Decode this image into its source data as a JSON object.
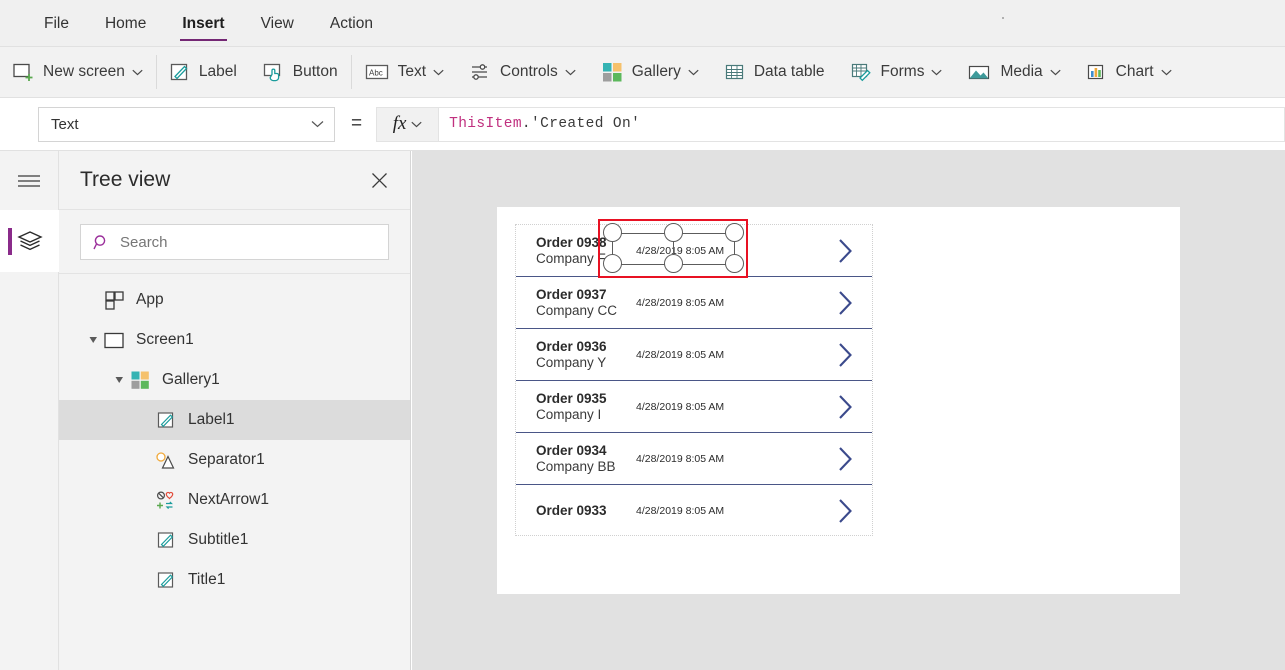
{
  "menu": {
    "items": [
      {
        "label": "File",
        "active": false
      },
      {
        "label": "Home",
        "active": false
      },
      {
        "label": "Insert",
        "active": true
      },
      {
        "label": "View",
        "active": false
      },
      {
        "label": "Action",
        "active": false
      }
    ]
  },
  "ribbon": {
    "items": [
      {
        "label": "New screen",
        "icon": "new-screen-icon",
        "caret": true
      },
      {
        "label": "Label",
        "icon": "label-icon",
        "caret": false
      },
      {
        "label": "Button",
        "icon": "button-icon",
        "caret": false
      },
      {
        "label": "Text",
        "icon": "text-abc-icon",
        "caret": true
      },
      {
        "label": "Controls",
        "icon": "controls-sliders-icon",
        "caret": true
      },
      {
        "label": "Gallery",
        "icon": "gallery-grid-icon",
        "caret": true
      },
      {
        "label": "Data table",
        "icon": "data-table-icon",
        "caret": false
      },
      {
        "label": "Forms",
        "icon": "forms-icon",
        "caret": true
      },
      {
        "label": "Media",
        "icon": "media-image-icon",
        "caret": true
      },
      {
        "label": "Chart",
        "icon": "chart-bar-icon",
        "caret": true
      }
    ]
  },
  "formula_bar": {
    "property": "Text",
    "equals": "=",
    "fx_label": "fx",
    "formula_object": "ThisItem",
    "formula_rest": ".'Created On'",
    "formula_full": "ThisItem.'Created On'"
  },
  "rail": {
    "hamburger_icon": "hamburger-menu-icon",
    "layers_icon": "layers-tree-view-icon"
  },
  "tree_view": {
    "title": "Tree view",
    "close_icon": "close-icon",
    "search": {
      "placeholder": "Search",
      "icon": "search-icon"
    },
    "nodes": [
      {
        "label": "App",
        "icon": "app-icon",
        "indent": 1,
        "twisty": "none",
        "selected": false
      },
      {
        "label": "Screen1",
        "icon": "screen-icon",
        "indent": 1,
        "twisty": "expanded",
        "selected": false
      },
      {
        "label": "Gallery1",
        "icon": "gallery-icon",
        "indent": 2,
        "twisty": "expanded",
        "selected": false
      },
      {
        "label": "Label1",
        "icon": "label-icon",
        "indent": 3,
        "twisty": "none",
        "selected": true
      },
      {
        "label": "Separator1",
        "icon": "separator-icon",
        "indent": 3,
        "twisty": "none",
        "selected": false
      },
      {
        "label": "NextArrow1",
        "icon": "next-arrow-icon",
        "indent": 3,
        "twisty": "none",
        "selected": false
      },
      {
        "label": "Subtitle1",
        "icon": "label-icon",
        "indent": 3,
        "twisty": "none",
        "selected": false
      },
      {
        "label": "Title1",
        "icon": "label-icon",
        "indent": 3,
        "twisty": "none",
        "selected": false
      }
    ]
  },
  "canvas": {
    "gallery": {
      "rows": [
        {
          "title": "Order 0938",
          "subtitle": "Company F",
          "date": "4/28/2019 8:05 AM",
          "chevron": "chevron-right-icon"
        },
        {
          "title": "Order 0937",
          "subtitle": "Company CC",
          "date": "4/28/2019 8:05 AM",
          "chevron": "chevron-right-icon"
        },
        {
          "title": "Order 0936",
          "subtitle": "Company Y",
          "date": "4/28/2019 8:05 AM",
          "chevron": "chevron-right-icon"
        },
        {
          "title": "Order 0935",
          "subtitle": "Company I",
          "date": "4/28/2019 8:05 AM",
          "chevron": "chevron-right-icon"
        },
        {
          "title": "Order 0934",
          "subtitle": "Company BB",
          "date": "4/28/2019 8:05 AM",
          "chevron": "chevron-right-icon"
        },
        {
          "title": "Order 0933",
          "subtitle": "",
          "date": "4/28/2019 8:05 AM",
          "chevron": "chevron-right-icon"
        }
      ]
    },
    "selection": {
      "name": "selected-control-label1",
      "color": "#e81123",
      "handle_count": 6
    }
  },
  "colors": {
    "accent_purple": "#742774",
    "selection_red": "#e81123",
    "chevron_blue": "#3b4a8c",
    "teal": "#1a9c9c",
    "canvas_bg": "#e1e1e1",
    "panel_bg": "#f3f3f3",
    "ribbon_bg": "#f2f2f2"
  }
}
